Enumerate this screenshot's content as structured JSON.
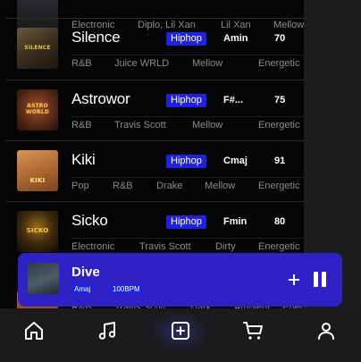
{
  "colors": {
    "accent": "#1f22e0",
    "player_bg": "#3021c4",
    "tag_text": "#8b8b90"
  },
  "tracks": [
    {
      "title": "",
      "thumb_text": "",
      "tags": [
        "Electronic",
        "Diplo, Lil Xan",
        "Lil Xan",
        "Mellow"
      ]
    },
    {
      "title": "Silence",
      "genre": "Hiphop",
      "key": "Amin",
      "bpm": "70",
      "thumb_text": "SILENCE",
      "tags": [
        "R&B",
        "Juice WRLD",
        "Mellow",
        "Energetic"
      ]
    },
    {
      "title": "Astrowor",
      "genre": "Hiphop",
      "key": "F#...",
      "bpm": "75",
      "thumb_text": "ASTRO WORLD",
      "tags": [
        "R&B",
        "Travis Scott",
        "Mellow",
        "Energetic"
      ]
    },
    {
      "title": "Kiki",
      "genre": "Hiphop",
      "key": "Cmaj",
      "bpm": "91",
      "thumb_text": "KIKI",
      "tags": [
        "Pop",
        "R&B",
        "Drake",
        "Mellow",
        "Energetic"
      ]
    },
    {
      "title": "Sicko",
      "genre": "Hiphop",
      "key": "Fmin",
      "bpm": "80",
      "thumb_text": "SICKO",
      "tags": [
        "Electronic",
        "Travis Scott",
        "Dirty",
        "Energetic"
      ]
    },
    {
      "title": "",
      "tags": [
        "R&B",
        "Travis Scott",
        "Dark",
        "Ambient",
        "Energetic"
      ]
    }
  ],
  "player": {
    "title": "Dive",
    "key": "Amaj",
    "bpm": "100BPM",
    "state": "playing"
  },
  "nav": {
    "items": [
      {
        "icon": "home-icon"
      },
      {
        "icon": "music-note-icon"
      },
      {
        "icon": "add-square-icon",
        "active": true
      },
      {
        "icon": "cart-icon"
      },
      {
        "icon": "user-icon"
      }
    ]
  }
}
